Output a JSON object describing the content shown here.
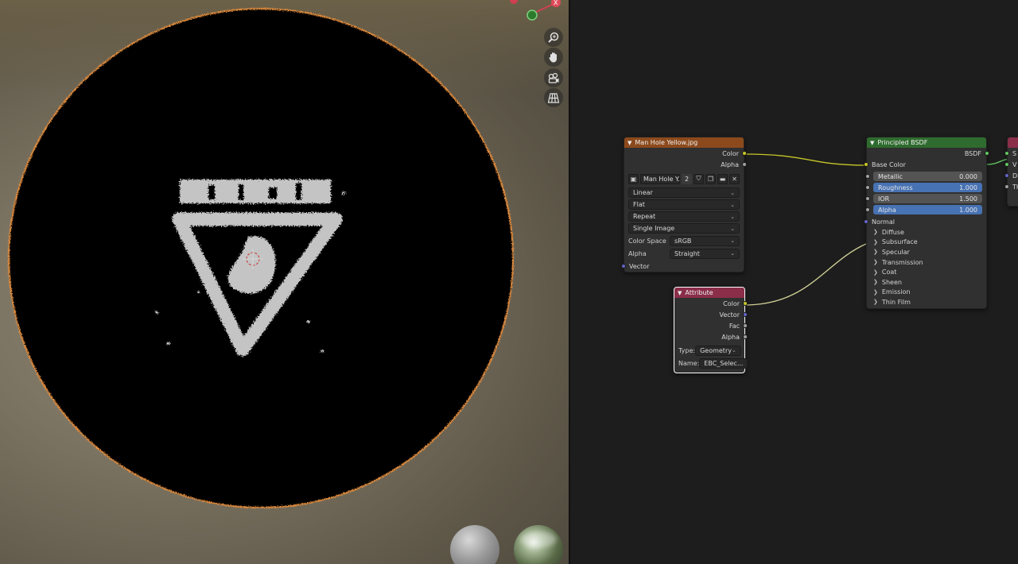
{
  "viewport": {
    "tools": [
      {
        "name": "zoom-icon"
      },
      {
        "name": "hand-pan-icon"
      },
      {
        "name": "camera-view-icon"
      },
      {
        "name": "grid-perspective-icon"
      }
    ]
  },
  "colors": {
    "image_texture_header": "#8c4a1c",
    "shader_header": "#2e6b2e",
    "attribute_header": "#8a2e4a",
    "link_yellow": "#c7c729",
    "selection_outline": "#e08a3a"
  },
  "image_node": {
    "title": "Man Hole Yellow.jpg",
    "outputs": [
      "Color",
      "Alpha"
    ],
    "image_name": "Man Hole Y...",
    "user_count": "2",
    "interpolation": "Linear",
    "projection": "Flat",
    "extension": "Repeat",
    "source": "Single Image",
    "color_space_label": "Color Space",
    "color_space": "sRGB",
    "alpha_label": "Alpha",
    "alpha_mode": "Straight",
    "input": "Vector"
  },
  "attribute_node": {
    "title": "Attribute",
    "outputs": [
      "Color",
      "Vector",
      "Fac",
      "Alpha"
    ],
    "type_label": "Type:",
    "type_value": "Geometry",
    "name_label": "Name:",
    "name_value": "EBC_Selec..."
  },
  "bsdf_node": {
    "title": "Principled BSDF",
    "output": "BSDF",
    "base_color": "Base Color",
    "sliders": [
      {
        "label": "Metallic",
        "value": "0.000",
        "style": "grey"
      },
      {
        "label": "Roughness",
        "value": "1.000",
        "style": "blue"
      },
      {
        "label": "IOR",
        "value": "1.500",
        "style": "grey"
      },
      {
        "label": "Alpha",
        "value": "1.000",
        "style": "blue"
      }
    ],
    "normal": "Normal",
    "panels": [
      "Diffuse",
      "Subsurface",
      "Specular",
      "Transmission",
      "Coat",
      "Sheen",
      "Emission",
      "Thin Film"
    ]
  },
  "output_node": {
    "sockets": [
      "S",
      "V",
      "Di",
      "Th"
    ]
  }
}
